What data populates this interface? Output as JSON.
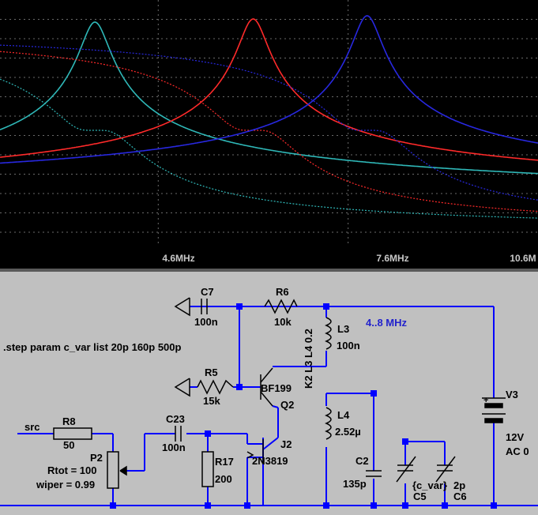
{
  "plot": {
    "x_ticks": [
      "4.6MHz",
      "7.6MHz",
      "10.6M"
    ]
  },
  "chart_data": {
    "type": "line",
    "x_tick_labels": [
      "4.6MHz",
      "7.6MHz",
      "10.6M"
    ],
    "x_unit": "MHz",
    "x_range": [
      2.1,
      10.6
    ],
    "grid": true,
    "series": [
      {
        "color": "#2fb8b8",
        "peak_x_mhz": 3.6,
        "line_style": "solid+dotted"
      },
      {
        "color": "#ff2a2a",
        "peak_x_mhz": 6.1,
        "line_style": "solid+dotted"
      },
      {
        "color": "#2828e0",
        "peak_x_mhz": 7.9,
        "line_style": "solid+dotted"
      }
    ]
  },
  "schematic": {
    "step_directive": ".step param c_var list 20p 160p 500p",
    "freq_note": "4..8 MHz",
    "coupling": "K2 L3 L4 0.2",
    "components": {
      "c7": {
        "name": "C7",
        "value": "100n"
      },
      "r6": {
        "name": "R6",
        "value": "10k"
      },
      "l3": {
        "name": "L3",
        "value": "100n"
      },
      "r5": {
        "name": "R5",
        "value": "15k"
      },
      "q2": {
        "model": "BF199",
        "name": "Q2"
      },
      "v3": {
        "name": "V3",
        "value": "12V",
        "ac": "AC 0",
        "plus": "+"
      },
      "l4": {
        "name": "L4",
        "value": "2.52µ"
      },
      "c2": {
        "name": "C2",
        "value": "135p"
      },
      "c5": {
        "name": "C5",
        "value": "{c_var}"
      },
      "c6": {
        "name": "C6",
        "value": "2p"
      },
      "r8": {
        "name": "R8",
        "value": "50"
      },
      "src": {
        "label": "src"
      },
      "p2": {
        "name": "P2",
        "rtot": "Rtot = 100",
        "wiper": "wiper = 0.99"
      },
      "c23": {
        "name": "C23",
        "value": "100n"
      },
      "r17": {
        "name": "R17",
        "value": "200"
      },
      "j2": {
        "name": "J2",
        "model": "2N3819"
      }
    }
  }
}
